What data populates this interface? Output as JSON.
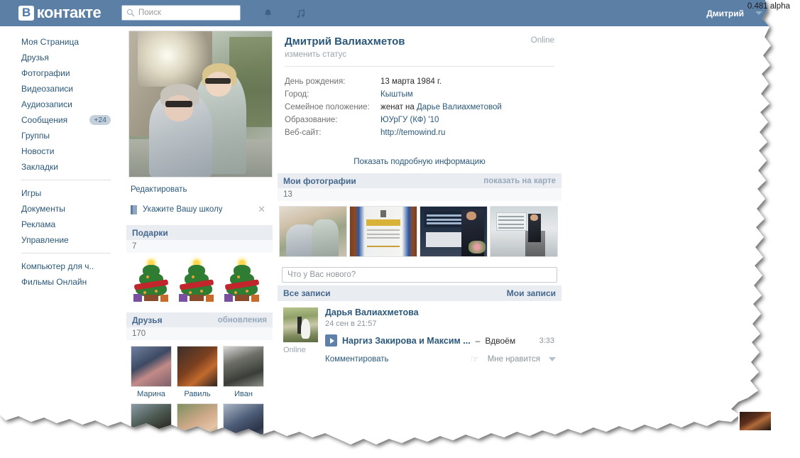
{
  "header": {
    "logo_v": "В",
    "logo_text": "контакте",
    "search_placeholder": "Поиск",
    "search_value": "",
    "search_icon": "search-icon",
    "bell_icon": "bell-icon",
    "music_icon": "music-note-icon",
    "user_name": "Дмитрий",
    "caret_icon": "chevron-down-icon",
    "bg_color": "#5c7fa6"
  },
  "watermark": {
    "text": "0.481 alpha"
  },
  "sidebar": {
    "group1": [
      {
        "label": "Моя Страница"
      },
      {
        "label": "Друзья"
      },
      {
        "label": "Фотографии"
      },
      {
        "label": "Видеозаписи"
      },
      {
        "label": "Аудиозаписи"
      },
      {
        "label": "Сообщения",
        "badge": "+24"
      },
      {
        "label": "Группы"
      },
      {
        "label": "Новости"
      },
      {
        "label": "Закладки"
      }
    ],
    "group2": [
      {
        "label": "Игры"
      },
      {
        "label": "Документы"
      },
      {
        "label": "Реклама"
      },
      {
        "label": "Управление"
      }
    ],
    "group3": [
      {
        "label": "Компьютер для ч.."
      },
      {
        "label": "Фильмы Онлайн"
      }
    ]
  },
  "left_column": {
    "edit_link": "Редактировать",
    "school_prompt": {
      "label": "Укажите Вашу школу",
      "icon": "book-icon",
      "close_icon": "close-icon"
    },
    "gifts": {
      "title": "Подарки",
      "count": "7",
      "items": [
        {
          "name": "christmas-tree-gift"
        },
        {
          "name": "christmas-tree-gift"
        },
        {
          "name": "christmas-tree-gift"
        }
      ]
    },
    "friends": {
      "title": "Друзья",
      "action": "обновления",
      "count": "170",
      "items": [
        {
          "name": "Марина"
        },
        {
          "name": "Равиль"
        },
        {
          "name": "Иван"
        },
        {
          "name": ""
        },
        {
          "name": ""
        },
        {
          "name": ""
        }
      ]
    }
  },
  "profile": {
    "name": "Дмитрий Валиахметов",
    "online": "Online",
    "status_link": "изменить статус",
    "fields": [
      {
        "label": "День рождения:",
        "value": "13 марта 1984 г.",
        "link": false
      },
      {
        "label": "Город:",
        "value": "Кыштым",
        "link": true
      },
      {
        "label": "Семейное положение:",
        "prefix": "женат на ",
        "value": "Дарье Валиахметовой",
        "link": true
      },
      {
        "label": "Образование:",
        "value": "ЮУрГУ (КФ) '10",
        "link": true
      },
      {
        "label": "Веб-сайт:",
        "value": "http://temowind.ru",
        "link": true
      }
    ],
    "show_more": "Показать подробную информацию"
  },
  "photos": {
    "title": "Мои фотографии",
    "action": "показать на карте",
    "count": "13",
    "items": [
      {
        "name": "photo-couple-outdoors"
      },
      {
        "name": "photo-diploma-certificate"
      },
      {
        "name": "photo-award-ceremony"
      },
      {
        "name": "photo-presentation-podium"
      }
    ]
  },
  "wall": {
    "input_placeholder": "Что у Вас нового?",
    "input_value": "",
    "tab_all": "Все записи",
    "tab_mine": "Мои записи",
    "posts": [
      {
        "author": "Дарья Валиахметова",
        "date": "24 сен в 21:57",
        "online": "Online",
        "audio": {
          "artist": "Наргиз Закирова и Максим ...",
          "dash": "–",
          "title": "Вдвоём",
          "duration": "3:33",
          "play_icon": "play-icon"
        },
        "comment_link": "Комментировать",
        "share_icon": "share-icon",
        "like_label": "Мне нравится",
        "like_caret_icon": "chevron-down-icon"
      }
    ]
  }
}
